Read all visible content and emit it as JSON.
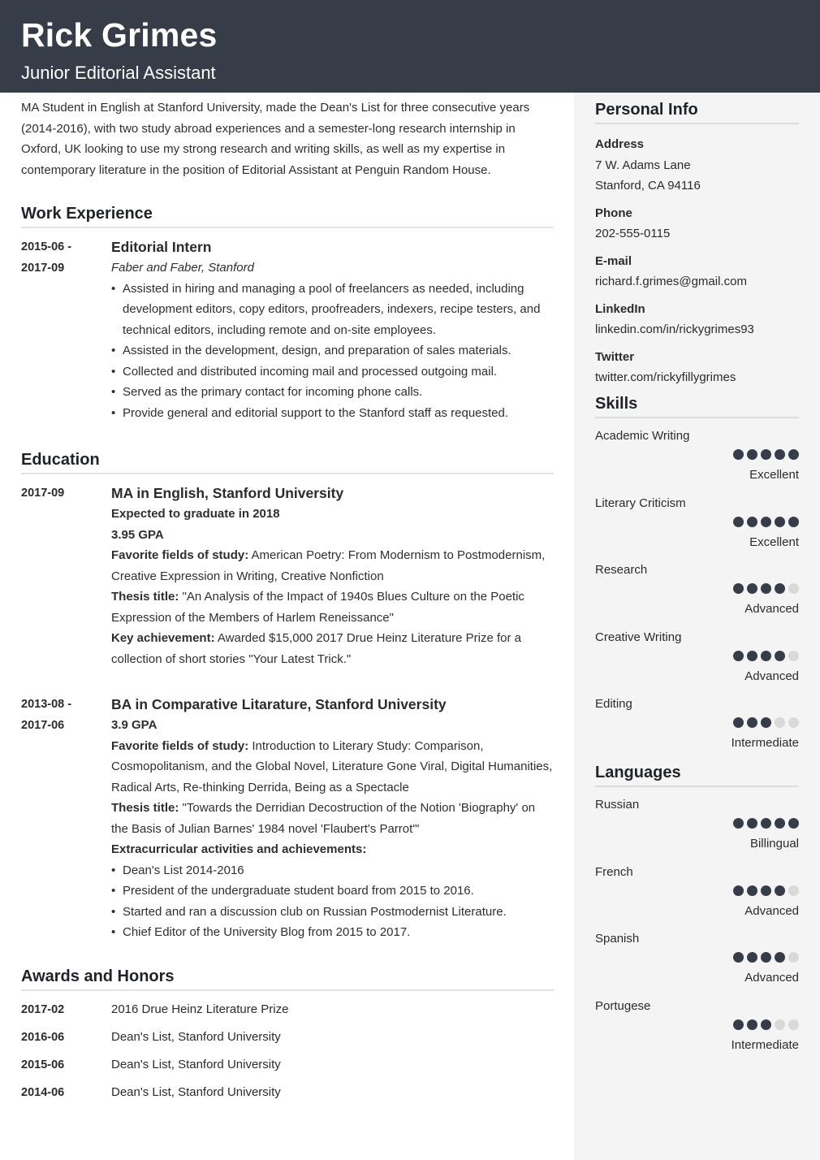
{
  "header": {
    "name": "Rick Grimes",
    "title": "Junior Editorial Assistant",
    "bg_color": "#373d48"
  },
  "summary": "MA Student in English at Stanford University, made the Dean's List for three consecutive years (2014-2016), with two study abroad experiences and a semester-long research internship in Oxford, UK looking to use my strong research and writing skills, as well as my expertise in contemporary literature in the position of Editorial Assistant at Penguin Random House.",
  "work": {
    "title": "Work Experience",
    "entries": [
      {
        "date": "2015-06 -\n2017-09",
        "position": "Editorial Intern",
        "company": "Faber and Faber, Stanford",
        "bullets": [
          "Assisted in hiring and managing a pool of freelancers as needed, including development editors, copy editors, proofreaders, indexers, recipe testers, and technical editors, including remote and on-site employees.",
          "Assisted in the development, design, and preparation of sales materials.",
          "Collected and distributed incoming mail and processed outgoing mail.",
          "Served as the primary contact for incoming phone calls.",
          "Provide general and editorial support to the Stanford staff as requested."
        ]
      }
    ]
  },
  "education": {
    "title": "Education",
    "entries": [
      {
        "date": "2017-09",
        "degree": "MA in English, Stanford University",
        "expected": "Expected to graduate in 2018",
        "gpa": "3.95 GPA",
        "fields_label": "Favorite fields of study:",
        "fields": "American Poetry: From Modernism to Postmodernism, Creative Expression in Writing, Creative Nonfiction",
        "thesis_label": "Thesis title:",
        "thesis": "\"An Analysis of the Impact of 1940s Blues Culture on the Poetic Expression of the Members of Harlem Reneissance\"",
        "achievement_label": "Key achievement:",
        "achievement": "Awarded $15,000 2017 Drue Heinz Literature Prize for a collection of short stories \"Your Latest Trick.\""
      },
      {
        "date": "2013-08 -\n2017-06",
        "degree": "BA in Comparative Litarature, Stanford University",
        "gpa": "3.9 GPA",
        "fields_label": "Favorite fields of study:",
        "fields": "Introduction to Literary Study: Comparison, Cosmopolitanism, and the Global Novel, Literature Gone Viral, Digital Humanities, Radical Arts, Re-thinking Derrida, Being as a Spectacle",
        "thesis_label": "Thesis title:",
        "thesis": "\"Towards the Derridian Decostruction of the Notion 'Biography' on the Basis of Julian Barnes' 1984 novel 'Flaubert's Parrot'\"",
        "extra_label": "Extracurricular activities and achievements:",
        "bullets": [
          "Dean's List 2014-2016",
          "President of the undergraduate student board from 2015 to 2016.",
          "Started and ran a discussion club on Russian Postmodernist Literature.",
          "Chief Editor of the University Blog from 2015 to 2017."
        ]
      }
    ]
  },
  "awards": {
    "title": "Awards and Honors",
    "items": [
      {
        "date": "2017-02",
        "name": "2016 Drue Heinz Literature Prize"
      },
      {
        "date": "2016-06",
        "name": "Dean's List, Stanford University"
      },
      {
        "date": "2015-06",
        "name": "Dean's List, Stanford University"
      },
      {
        "date": "2014-06",
        "name": "Dean's List, Stanford University"
      }
    ]
  },
  "personal_info": {
    "title": "Personal Info",
    "address_label": "Address",
    "address_line1": "7 W. Adams Lane",
    "address_line2": "Stanford, CA 94116",
    "phone_label": "Phone",
    "phone": "202-555-0115",
    "email_label": "E-mail",
    "email": "richard.f.grimes@gmail.com",
    "linkedin_label": "LinkedIn",
    "linkedin": "linkedin.com/in/rickygrimes93",
    "twitter_label": "Twitter",
    "twitter": "twitter.com/rickyfillygrimes"
  },
  "skills": {
    "title": "Skills",
    "items": [
      {
        "name": "Academic Writing",
        "rating": 5,
        "max": 5,
        "level": "Excellent"
      },
      {
        "name": "Literary Criticism",
        "rating": 5,
        "max": 5,
        "level": "Excellent"
      },
      {
        "name": "Research",
        "rating": 4,
        "max": 5,
        "level": "Advanced"
      },
      {
        "name": "Creative Writing",
        "rating": 4,
        "max": 5,
        "level": "Advanced"
      },
      {
        "name": "Editing",
        "rating": 3,
        "max": 5,
        "level": "Intermediate"
      }
    ]
  },
  "languages": {
    "title": "Languages",
    "items": [
      {
        "name": "Russian",
        "rating": 5,
        "max": 5,
        "level": "Billingual"
      },
      {
        "name": "French",
        "rating": 4,
        "max": 5,
        "level": "Advanced"
      },
      {
        "name": "Spanish",
        "rating": 4,
        "max": 5,
        "level": "Advanced"
      },
      {
        "name": "Portugese",
        "rating": 3,
        "max": 5,
        "level": "Intermediate"
      }
    ]
  }
}
